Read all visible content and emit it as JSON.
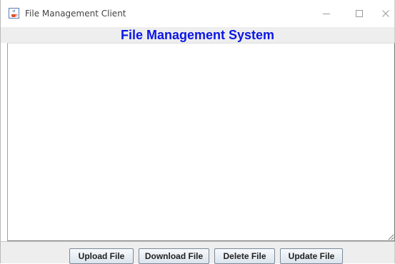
{
  "window": {
    "title": "File Management Client",
    "controls": {
      "minimize": "—",
      "maximize": "☐",
      "close": "✕"
    }
  },
  "heading": "File Management System",
  "text_area": {
    "value": ""
  },
  "buttons": {
    "upload": "Upload File",
    "download": "Download File",
    "delete": "Delete File",
    "update": "Update File"
  },
  "colors": {
    "heading": "#0b16e6",
    "panel": "#eeeeee"
  },
  "icons": {
    "app": "java-coffee-cup-icon"
  }
}
